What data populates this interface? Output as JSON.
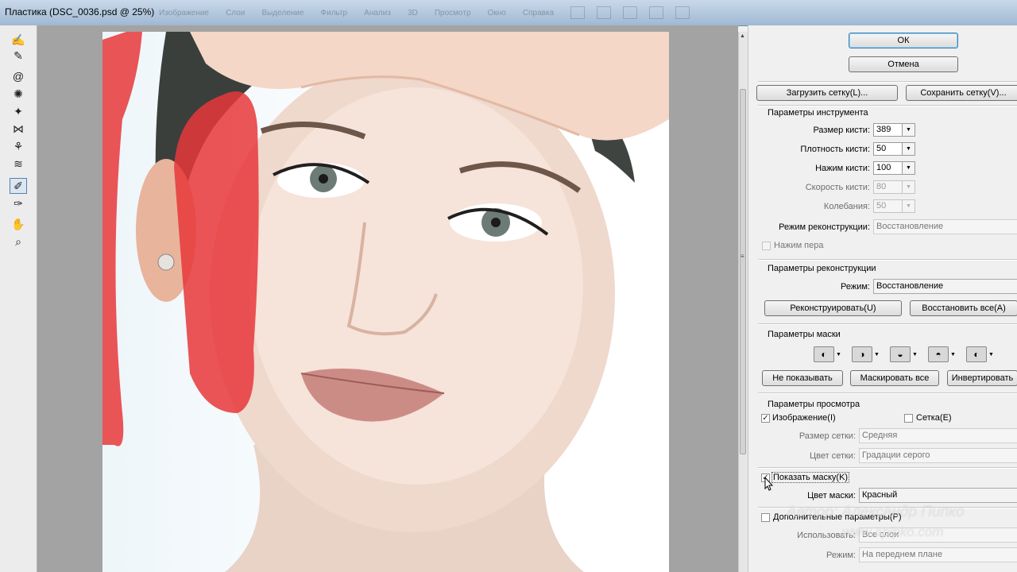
{
  "window": {
    "title": "Пластика (DSC_0036.psd @ 25%)"
  },
  "ghost_menu": [
    "Изображение",
    "Слои",
    "Выделение",
    "Фильтр",
    "Анализ",
    "3D",
    "Просмотр",
    "Окно",
    "Справка"
  ],
  "tools": [
    {
      "name": "forward-warp-icon",
      "glyph": "✍"
    },
    {
      "name": "reconstruct-icon",
      "glyph": "✎"
    },
    {
      "name": "twirl-icon",
      "glyph": "@"
    },
    {
      "name": "pucker-icon",
      "glyph": "✺"
    },
    {
      "name": "bloat-icon",
      "glyph": "✦"
    },
    {
      "name": "push-left-icon",
      "glyph": "⋈"
    },
    {
      "name": "mirror-icon",
      "glyph": "⚘"
    },
    {
      "name": "turbulence-icon",
      "glyph": "≋"
    },
    {
      "name": "freeze-mask-icon",
      "glyph": "✐"
    },
    {
      "name": "thaw-mask-icon",
      "glyph": "✑"
    },
    {
      "name": "hand-icon",
      "glyph": "✋"
    },
    {
      "name": "zoom-icon",
      "glyph": "⌕"
    }
  ],
  "buttons": {
    "ok": "ОК",
    "cancel": "Отмена",
    "load_mesh": "Загрузить сетку(L)...",
    "save_mesh": "Сохранить сетку(V)...",
    "reconstruct": "Реконструировать(U)",
    "restore_all": "Восстановить все(A)",
    "none": "Не показывать",
    "mask_all": "Маскировать все",
    "invert": "Инвертировать"
  },
  "tool_options": {
    "title": "Параметры инструмента",
    "brush_size_label": "Размер кисти:",
    "brush_size": "389",
    "brush_density_label": "Плотность кисти:",
    "brush_density": "50",
    "brush_pressure_label": "Нажим кисти:",
    "brush_pressure": "100",
    "brush_rate_label": "Скорость кисти:",
    "brush_rate": "80",
    "turbulent_jitter_label": "Колебания:",
    "turbulent_jitter": "50",
    "reconstruct_mode_label": "Режим реконструкции:",
    "reconstruct_mode": "Восстановление",
    "stylus_pressure_label": "Нажим пера"
  },
  "reconstruct_options": {
    "title": "Параметры реконструкции",
    "mode_label": "Режим:",
    "mode": "Восстановление"
  },
  "mask_options": {
    "title": "Параметры маски"
  },
  "view_options": {
    "title": "Параметры просмотра",
    "show_image_label": "Изображение(I)",
    "show_image": true,
    "show_mesh_label": "Сетка(E)",
    "show_mesh": false,
    "mesh_size_label": "Размер сетки:",
    "mesh_size": "Средняя",
    "mesh_color_label": "Цвет сетки:",
    "mesh_color": "Градации серого",
    "show_mask_label": "Показать маску(K)",
    "show_mask": true,
    "mask_color_label": "Цвет маски:",
    "mask_color": "Красный",
    "show_backdrop_label": "Дополнительные параметры(P)",
    "show_backdrop": false,
    "use_label": "Использовать:",
    "use": "Все слои",
    "mode_label": "Режим:",
    "mode": "На переднем плане"
  },
  "watermark": {
    "line1": "Автор: Александр Пипко",
    "line2": "www.apipko.com"
  },
  "colors": {
    "mask": "#e8373a",
    "default_button": "#3c7fb1"
  }
}
